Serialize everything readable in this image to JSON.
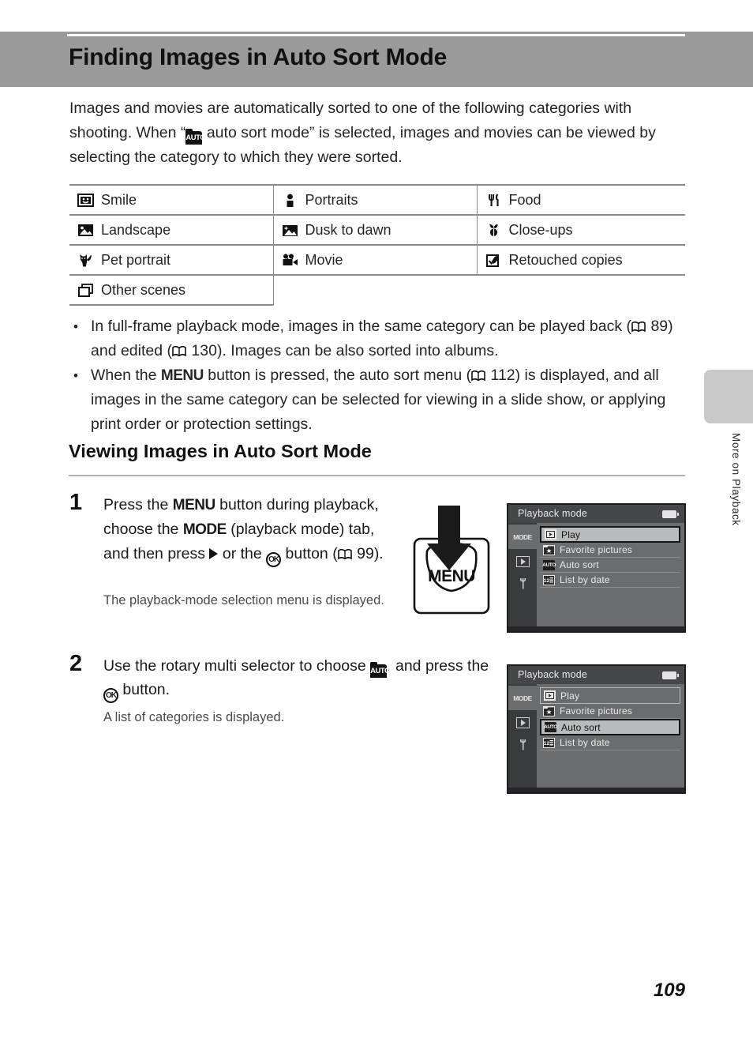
{
  "document": {
    "page_number": "109",
    "side_tab_label": "More on Playback"
  },
  "header": {
    "title": "Finding Images in Auto Sort Mode"
  },
  "intro": {
    "part1": "Images and movies are automatically sorted to one of the following categories with shooting. When “",
    "auto_icon": "AUTO",
    "part2": " auto sort mode” is selected, images and movies can be viewed by selecting the category to which they were sorted."
  },
  "categories": {
    "rows": [
      [
        {
          "icon": "smile-icon",
          "label": "Smile"
        },
        {
          "icon": "portraits-icon",
          "label": "Portraits"
        },
        {
          "icon": "food-icon",
          "label": "Food"
        }
      ],
      [
        {
          "icon": "landscape-icon",
          "label": "Landscape"
        },
        {
          "icon": "dusk-to-dawn-icon",
          "label": "Dusk to dawn"
        },
        {
          "icon": "close-ups-icon",
          "label": "Close-ups"
        }
      ],
      [
        {
          "icon": "pet-portrait-icon",
          "label": "Pet portrait"
        },
        {
          "icon": "movie-icon",
          "label": "Movie"
        },
        {
          "icon": "retouched-copies-icon",
          "label": "Retouched copies"
        }
      ],
      [
        {
          "icon": "other-scenes-icon",
          "label": "Other scenes"
        }
      ]
    ]
  },
  "bullets": [
    {
      "marker": "•",
      "t1": "In full-frame playback mode, images in the same category can be played back (",
      "ref1": "89",
      "t2": ") and edited (",
      "ref2": "130",
      "t3": "). Images can be also sorted into albums."
    },
    {
      "marker": "•",
      "t1": "When the ",
      "kw": "MENU",
      "t2": " button is pressed, the auto sort menu (",
      "ref1": "112",
      "t3": ") is displayed, and all images in the same category can be selected for viewing in a slide show, or applying print order or protection settings."
    }
  ],
  "section": {
    "heading": "Viewing Images in Auto Sort Mode"
  },
  "steps": [
    {
      "number": "1",
      "t1": "Press the ",
      "kw_menu": "MENU",
      "t2": " button during playback, choose the ",
      "kw_mode": "MODE",
      "t3": " (playback mode) tab, and then press ",
      "t4": " or the ",
      "ok": "OK",
      "t5": " button (",
      "ref": "99",
      "t6": ").",
      "note": "The playback-mode selection menu is displayed."
    },
    {
      "number": "2",
      "t1": "Use the rotary multi selector to choose ",
      "auto_icon": "AUTO",
      "t2": ", and press the ",
      "ok": "OK",
      "t3": " button.",
      "note": "A list of categories is displayed."
    }
  ],
  "menu_button_graphic": {
    "label": "MENU"
  },
  "lcd_screens": [
    {
      "title": "Playback mode",
      "tabs": [
        {
          "name": "mode-tab",
          "label": "MODE",
          "selected": true
        },
        {
          "name": "playback-tab",
          "label": "",
          "selected": false
        },
        {
          "name": "setup-tab",
          "label": "",
          "selected": false
        }
      ],
      "items": [
        {
          "icon": "play-icon",
          "label": "Play",
          "state": "highlighted"
        },
        {
          "icon": "favorite-icon",
          "label": "Favorite pictures",
          "state": "normal"
        },
        {
          "icon": "auto-sort-icon",
          "label": "Auto sort",
          "state": "normal"
        },
        {
          "icon": "list-by-date-icon",
          "label": "List by date",
          "state": "normal"
        }
      ]
    },
    {
      "title": "Playback mode",
      "tabs": [
        {
          "name": "mode-tab",
          "label": "MODE",
          "selected": true
        },
        {
          "name": "playback-tab",
          "label": "",
          "selected": false
        },
        {
          "name": "setup-tab",
          "label": "",
          "selected": false
        }
      ],
      "items": [
        {
          "icon": "play-icon",
          "label": "Play",
          "state": "outline"
        },
        {
          "icon": "favorite-icon",
          "label": "Favorite pictures",
          "state": "normal"
        },
        {
          "icon": "auto-sort-icon",
          "label": "Auto sort",
          "state": "highlighted"
        },
        {
          "icon": "list-by-date-icon",
          "label": "List by date",
          "state": "normal"
        }
      ]
    }
  ],
  "colors": {
    "header_band": "#9a9a9a",
    "side_tab": "#c9c9c9",
    "lcd_background": "#6b6c6e",
    "lcd_title_bar": "#46474a",
    "lcd_highlight": "#b9babb"
  }
}
